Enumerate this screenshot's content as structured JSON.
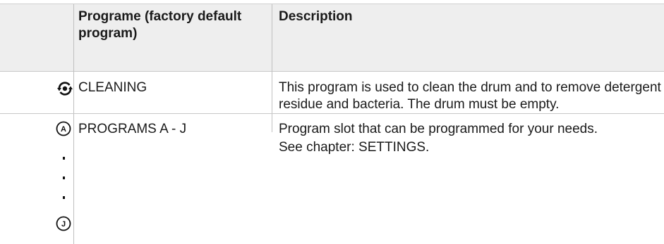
{
  "table": {
    "headers": {
      "icon": "",
      "program": "Programe (factory default program)",
      "description": "Description"
    },
    "rows": [
      {
        "icon": "cleaning-cycle-icon",
        "program": "CLEANING",
        "description": "This program is used to clean the drum and to remove detergent residue and bacteria. The drum must be empty."
      },
      {
        "icon_start": "letter-a-circle-icon",
        "icon_start_letter": "A",
        "icon_end": "letter-j-circle-icon",
        "icon_end_letter": "J",
        "program": "PROGRAMS A - J",
        "description_line1": "Program slot that can be programmed for your needs.",
        "description_line2": "See chapter: SETTINGS."
      }
    ]
  }
}
